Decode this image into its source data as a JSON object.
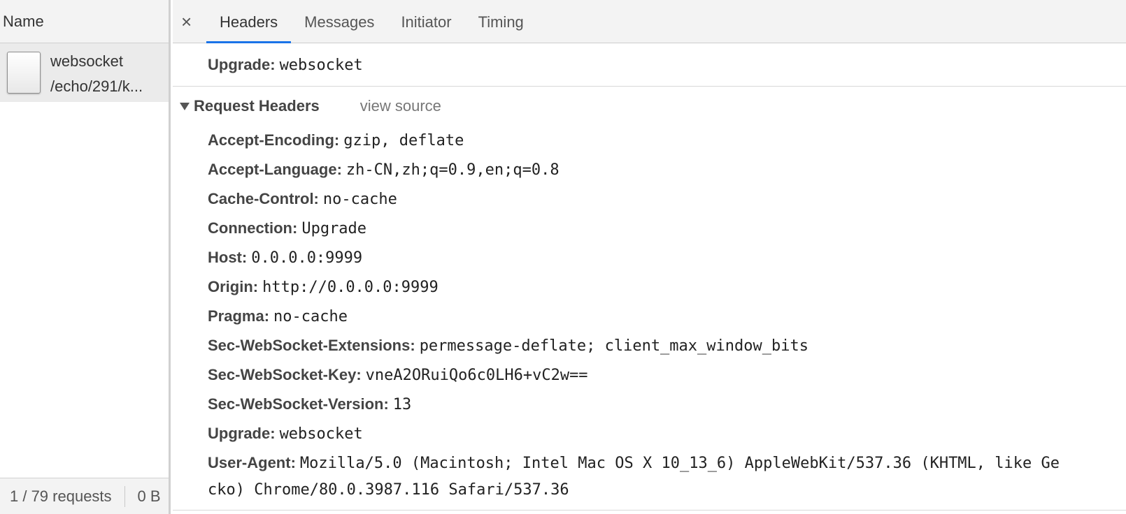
{
  "network": {
    "column_header": "Name",
    "requests": [
      {
        "name": "websocket",
        "path": "/echo/291/k..."
      }
    ],
    "footer": {
      "requests_text": "1 / 79 requests",
      "transferred_text": "0 B"
    }
  },
  "details": {
    "close_symbol": "×",
    "tabs": [
      "Headers",
      "Messages",
      "Initiator",
      "Timing"
    ],
    "active_tab": "Headers",
    "top_header": {
      "key": "Upgrade:",
      "value": "websocket"
    },
    "request_headers": {
      "title": "Request Headers",
      "view_source": "view source",
      "items": [
        {
          "key": "Accept-Encoding:",
          "value": "gzip, deflate"
        },
        {
          "key": "Accept-Language:",
          "value": "zh-CN,zh;q=0.9,en;q=0.8"
        },
        {
          "key": "Cache-Control:",
          "value": "no-cache"
        },
        {
          "key": "Connection:",
          "value": "Upgrade"
        },
        {
          "key": "Host:",
          "value": "0.0.0.0:9999"
        },
        {
          "key": "Origin:",
          "value": "http://0.0.0.0:9999"
        },
        {
          "key": "Pragma:",
          "value": "no-cache"
        },
        {
          "key": "Sec-WebSocket-Extensions:",
          "value": "permessage-deflate; client_max_window_bits"
        },
        {
          "key": "Sec-WebSocket-Key:",
          "value": "vneA2ORuiQo6c0LH6+vC2w=="
        },
        {
          "key": "Sec-WebSocket-Version:",
          "value": "13"
        },
        {
          "key": "Upgrade:",
          "value": "websocket"
        },
        {
          "key": "User-Agent:",
          "value": "Mozilla/5.0 (Macintosh; Intel Mac OS X 10_13_6) AppleWebKit/537.36 (KHTML, like Ge"
        }
      ],
      "user_agent_continuation": "cko) Chrome/80.0.3987.116 Safari/537.36"
    }
  }
}
